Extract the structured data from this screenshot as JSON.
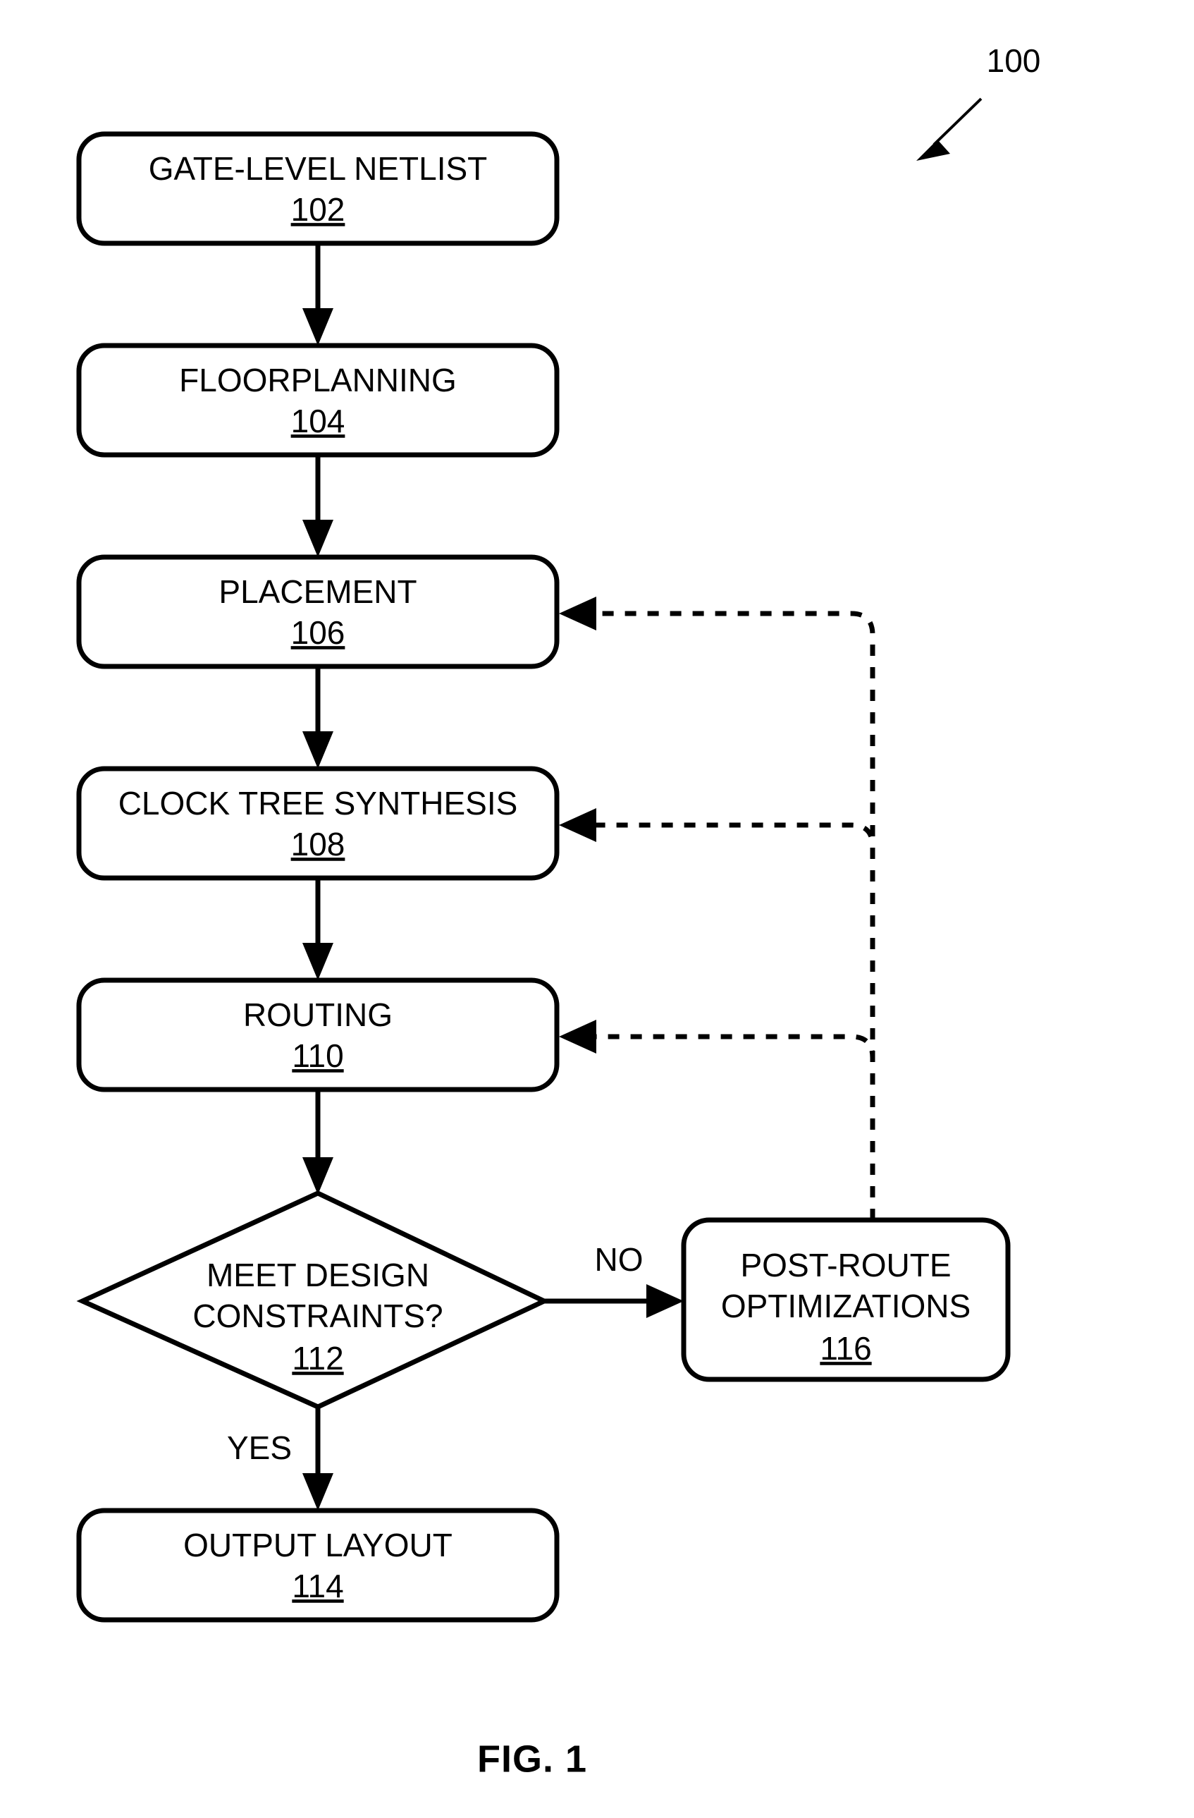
{
  "figure": {
    "caption": "FIG. 1",
    "reference_numeral": "100"
  },
  "nodes": {
    "gate_level_netlist": {
      "label": "GATE-LEVEL NETLIST",
      "ref": "102",
      "shape": "rounded-rectangle"
    },
    "floorplanning": {
      "label": "FLOORPLANNING",
      "ref": "104",
      "shape": "rounded-rectangle"
    },
    "placement": {
      "label": "PLACEMENT",
      "ref": "106",
      "shape": "rounded-rectangle"
    },
    "clock_tree_synthesis": {
      "label": "CLOCK TREE SYNTHESIS",
      "ref": "108",
      "shape": "rounded-rectangle"
    },
    "routing": {
      "label": "ROUTING",
      "ref": "110",
      "shape": "rounded-rectangle"
    },
    "meet_design_constraints": {
      "label_line1": "MEET DESIGN",
      "label_line2": "CONSTRAINTS?",
      "ref": "112",
      "shape": "diamond"
    },
    "output_layout": {
      "label": "OUTPUT LAYOUT",
      "ref": "114",
      "shape": "rounded-rectangle"
    },
    "post_route_optimizations": {
      "label_line1": "POST-ROUTE",
      "label_line2": "OPTIMIZATIONS",
      "ref": "116",
      "shape": "rounded-rectangle"
    }
  },
  "edges": {
    "decision_no": "NO",
    "decision_yes": "YES"
  },
  "colors": {
    "stroke": "#000000",
    "fill": "#ffffff",
    "background": "#ffffff"
  }
}
